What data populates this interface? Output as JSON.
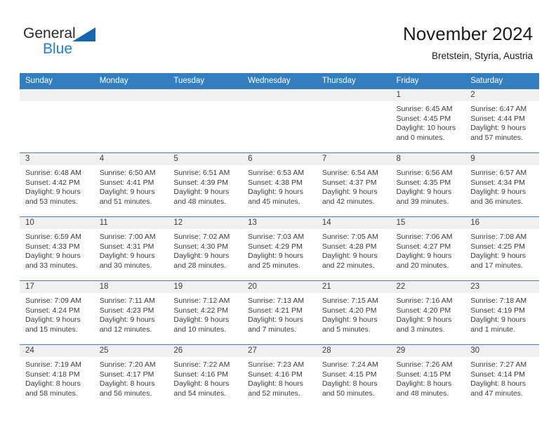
{
  "brand": {
    "word1": "General",
    "word2": "Blue",
    "triangle_icon": "brand-triangle-icon",
    "colors": {
      "word1": "#2b2b2b",
      "word2": "#1e7fd4",
      "triangle": "#1666b0"
    }
  },
  "header": {
    "title": "November 2024",
    "subtitle": "Bretstein, Styria, Austria"
  },
  "theme": {
    "header_row_bg": "#337ec0",
    "header_row_text": "#ffffff",
    "daynum_band_bg": "#f0f0f0",
    "row_border": "#4a7ebb",
    "body_text": "#3c3c3c"
  },
  "calendar": {
    "weekday_headers": [
      "Sunday",
      "Monday",
      "Tuesday",
      "Wednesday",
      "Thursday",
      "Friday",
      "Saturday"
    ],
    "labels": {
      "sunrise": "Sunrise:",
      "sunset": "Sunset:",
      "daylight": "Daylight:"
    },
    "weeks": [
      [
        {
          "day": "",
          "empty": true,
          "lines": []
        },
        {
          "day": "",
          "empty": true,
          "lines": []
        },
        {
          "day": "",
          "empty": true,
          "lines": []
        },
        {
          "day": "",
          "empty": true,
          "lines": []
        },
        {
          "day": "",
          "empty": true,
          "lines": []
        },
        {
          "day": "1",
          "empty": false,
          "lines": [
            "Sunrise: 6:45 AM",
            "Sunset: 4:45 PM",
            "Daylight: 10 hours",
            "and 0 minutes."
          ]
        },
        {
          "day": "2",
          "empty": false,
          "lines": [
            "Sunrise: 6:47 AM",
            "Sunset: 4:44 PM",
            "Daylight: 9 hours",
            "and 57 minutes."
          ]
        }
      ],
      [
        {
          "day": "3",
          "empty": false,
          "lines": [
            "Sunrise: 6:48 AM",
            "Sunset: 4:42 PM",
            "Daylight: 9 hours",
            "and 53 minutes."
          ]
        },
        {
          "day": "4",
          "empty": false,
          "lines": [
            "Sunrise: 6:50 AM",
            "Sunset: 4:41 PM",
            "Daylight: 9 hours",
            "and 51 minutes."
          ]
        },
        {
          "day": "5",
          "empty": false,
          "lines": [
            "Sunrise: 6:51 AM",
            "Sunset: 4:39 PM",
            "Daylight: 9 hours",
            "and 48 minutes."
          ]
        },
        {
          "day": "6",
          "empty": false,
          "lines": [
            "Sunrise: 6:53 AM",
            "Sunset: 4:38 PM",
            "Daylight: 9 hours",
            "and 45 minutes."
          ]
        },
        {
          "day": "7",
          "empty": false,
          "lines": [
            "Sunrise: 6:54 AM",
            "Sunset: 4:37 PM",
            "Daylight: 9 hours",
            "and 42 minutes."
          ]
        },
        {
          "day": "8",
          "empty": false,
          "lines": [
            "Sunrise: 6:56 AM",
            "Sunset: 4:35 PM",
            "Daylight: 9 hours",
            "and 39 minutes."
          ]
        },
        {
          "day": "9",
          "empty": false,
          "lines": [
            "Sunrise: 6:57 AM",
            "Sunset: 4:34 PM",
            "Daylight: 9 hours",
            "and 36 minutes."
          ]
        }
      ],
      [
        {
          "day": "10",
          "empty": false,
          "lines": [
            "Sunrise: 6:59 AM",
            "Sunset: 4:33 PM",
            "Daylight: 9 hours",
            "and 33 minutes."
          ]
        },
        {
          "day": "11",
          "empty": false,
          "lines": [
            "Sunrise: 7:00 AM",
            "Sunset: 4:31 PM",
            "Daylight: 9 hours",
            "and 30 minutes."
          ]
        },
        {
          "day": "12",
          "empty": false,
          "lines": [
            "Sunrise: 7:02 AM",
            "Sunset: 4:30 PM",
            "Daylight: 9 hours",
            "and 28 minutes."
          ]
        },
        {
          "day": "13",
          "empty": false,
          "lines": [
            "Sunrise: 7:03 AM",
            "Sunset: 4:29 PM",
            "Daylight: 9 hours",
            "and 25 minutes."
          ]
        },
        {
          "day": "14",
          "empty": false,
          "lines": [
            "Sunrise: 7:05 AM",
            "Sunset: 4:28 PM",
            "Daylight: 9 hours",
            "and 22 minutes."
          ]
        },
        {
          "day": "15",
          "empty": false,
          "lines": [
            "Sunrise: 7:06 AM",
            "Sunset: 4:27 PM",
            "Daylight: 9 hours",
            "and 20 minutes."
          ]
        },
        {
          "day": "16",
          "empty": false,
          "lines": [
            "Sunrise: 7:08 AM",
            "Sunset: 4:25 PM",
            "Daylight: 9 hours",
            "and 17 minutes."
          ]
        }
      ],
      [
        {
          "day": "17",
          "empty": false,
          "lines": [
            "Sunrise: 7:09 AM",
            "Sunset: 4:24 PM",
            "Daylight: 9 hours",
            "and 15 minutes."
          ]
        },
        {
          "day": "18",
          "empty": false,
          "lines": [
            "Sunrise: 7:11 AM",
            "Sunset: 4:23 PM",
            "Daylight: 9 hours",
            "and 12 minutes."
          ]
        },
        {
          "day": "19",
          "empty": false,
          "lines": [
            "Sunrise: 7:12 AM",
            "Sunset: 4:22 PM",
            "Daylight: 9 hours",
            "and 10 minutes."
          ]
        },
        {
          "day": "20",
          "empty": false,
          "lines": [
            "Sunrise: 7:13 AM",
            "Sunset: 4:21 PM",
            "Daylight: 9 hours",
            "and 7 minutes."
          ]
        },
        {
          "day": "21",
          "empty": false,
          "lines": [
            "Sunrise: 7:15 AM",
            "Sunset: 4:20 PM",
            "Daylight: 9 hours",
            "and 5 minutes."
          ]
        },
        {
          "day": "22",
          "empty": false,
          "lines": [
            "Sunrise: 7:16 AM",
            "Sunset: 4:20 PM",
            "Daylight: 9 hours",
            "and 3 minutes."
          ]
        },
        {
          "day": "23",
          "empty": false,
          "lines": [
            "Sunrise: 7:18 AM",
            "Sunset: 4:19 PM",
            "Daylight: 9 hours",
            "and 1 minute."
          ]
        }
      ],
      [
        {
          "day": "24",
          "empty": false,
          "lines": [
            "Sunrise: 7:19 AM",
            "Sunset: 4:18 PM",
            "Daylight: 8 hours",
            "and 58 minutes."
          ]
        },
        {
          "day": "25",
          "empty": false,
          "lines": [
            "Sunrise: 7:20 AM",
            "Sunset: 4:17 PM",
            "Daylight: 8 hours",
            "and 56 minutes."
          ]
        },
        {
          "day": "26",
          "empty": false,
          "lines": [
            "Sunrise: 7:22 AM",
            "Sunset: 4:16 PM",
            "Daylight: 8 hours",
            "and 54 minutes."
          ]
        },
        {
          "day": "27",
          "empty": false,
          "lines": [
            "Sunrise: 7:23 AM",
            "Sunset: 4:16 PM",
            "Daylight: 8 hours",
            "and 52 minutes."
          ]
        },
        {
          "day": "28",
          "empty": false,
          "lines": [
            "Sunrise: 7:24 AM",
            "Sunset: 4:15 PM",
            "Daylight: 8 hours",
            "and 50 minutes."
          ]
        },
        {
          "day": "29",
          "empty": false,
          "lines": [
            "Sunrise: 7:26 AM",
            "Sunset: 4:15 PM",
            "Daylight: 8 hours",
            "and 48 minutes."
          ]
        },
        {
          "day": "30",
          "empty": false,
          "lines": [
            "Sunrise: 7:27 AM",
            "Sunset: 4:14 PM",
            "Daylight: 8 hours",
            "and 47 minutes."
          ]
        }
      ]
    ]
  }
}
